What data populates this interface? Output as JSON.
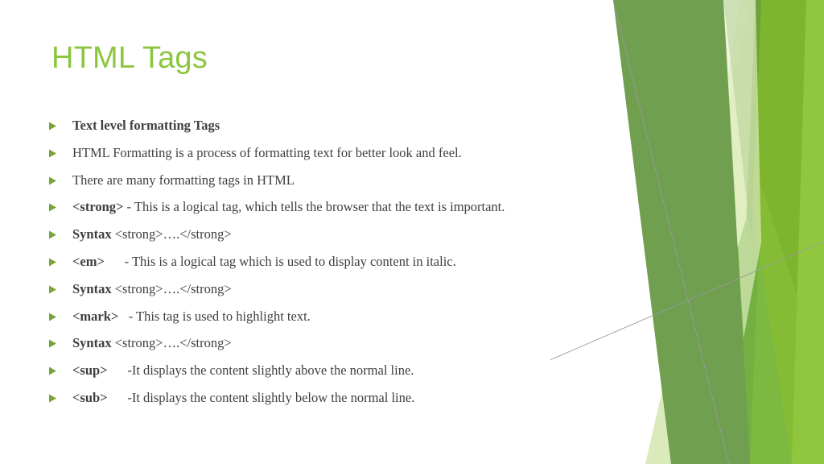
{
  "slide": {
    "title": "HTML Tags",
    "title_color": "#8CC63F",
    "body_text_color": "#3F3F3F",
    "background_color": "#FFFFFF",
    "bullet_marker_icon": "triangle-right-icon",
    "bullet_marker_color": "#76A636"
  },
  "theme_colors": {
    "dark_green": "#6F9F4F",
    "mid_green": "#72B043",
    "bright_green": "#7EB52E",
    "light_green": "#91C73E",
    "pale_green": "#DBEABB",
    "very_pale_green": "#E8F2CF",
    "hairline": "#9A9A9A"
  },
  "bullets": [
    {
      "lead": "Text level formatting Tags",
      "rest": "",
      "all_bold": true
    },
    {
      "lead": "",
      "rest": "HTML Formatting is a process of formatting text for better look and feel.",
      "all_bold": false
    },
    {
      "lead": "",
      "rest": "There are many formatting tags in HTML",
      "all_bold": false
    },
    {
      "lead": "<strong>",
      "rest": " - This is a logical tag, which tells the browser that the text is important.",
      "all_bold": false
    },
    {
      "lead": "Syntax",
      "rest": " <strong>….</strong>",
      "all_bold": false
    },
    {
      "lead": "<em>",
      "rest": "      - This is a logical tag which is used to display content in italic.",
      "all_bold": false
    },
    {
      "lead": "Syntax",
      "rest": " <strong>….</strong>",
      "all_bold": false
    },
    {
      "lead": "<mark>",
      "rest": "   - This tag is used to highlight text.",
      "all_bold": false
    },
    {
      "lead": "Syntax",
      "rest": " <strong>….</strong>",
      "all_bold": false
    },
    {
      "lead": "<sup>",
      "rest": "      -It displays the content slightly above the normal line.",
      "all_bold": false
    },
    {
      "lead": "<sub>",
      "rest": "      -It displays the content slightly below the normal line.",
      "all_bold": false
    }
  ]
}
